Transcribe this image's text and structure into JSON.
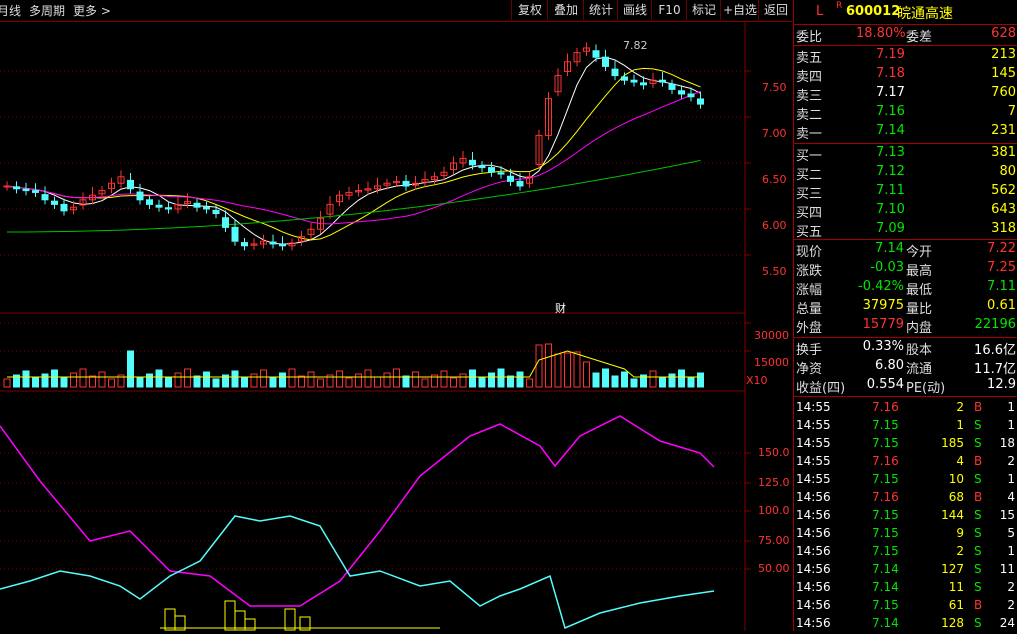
{
  "topbar": {
    "left_items": [
      "月线",
      "多周期",
      "更多 >"
    ],
    "buttons": [
      "复权",
      "叠加",
      "统计",
      "画线",
      "F10",
      "标记",
      "+自选",
      "返回"
    ]
  },
  "stock": {
    "code": "600012",
    "name": "皖通高速",
    "flag_l": "L",
    "flag_r": "R"
  },
  "colors": {
    "up": "#ff3232",
    "down": "#54fcfc",
    "flat": "#ffffff",
    "ma5": "#ffffff",
    "ma10": "#ffff00",
    "ma20": "#ff00ff",
    "ma60": "#00c000",
    "grid": "#800000"
  },
  "main_chart": {
    "peak_label": "7.82",
    "price_ticks": [
      "7.50",
      "7.00",
      "6.50",
      "6.00",
      "5.50"
    ],
    "marker": "财"
  },
  "volume_chart": {
    "ticks": [
      "30000",
      "15000"
    ],
    "unit": "X10"
  },
  "indicator_chart": {
    "ticks": [
      "150.0",
      "125.0",
      "100.0",
      "75.00",
      "50.00"
    ]
  },
  "quote": {
    "weibi": {
      "label": "委比",
      "value": "18.80%",
      "label2": "委差",
      "value2": "628"
    },
    "asks": [
      {
        "label": "卖五",
        "price": "7.19",
        "vol": "213"
      },
      {
        "label": "卖四",
        "price": "7.18",
        "vol": "145"
      },
      {
        "label": "卖三",
        "price": "7.17",
        "vol": "760"
      },
      {
        "label": "卖二",
        "price": "7.16",
        "vol": "7"
      },
      {
        "label": "卖一",
        "price": "7.14",
        "vol": "231"
      }
    ],
    "bids": [
      {
        "label": "买一",
        "price": "7.13",
        "vol": "381"
      },
      {
        "label": "买二",
        "price": "7.12",
        "vol": "80"
      },
      {
        "label": "买三",
        "price": "7.11",
        "vol": "562"
      },
      {
        "label": "买四",
        "price": "7.10",
        "vol": "643"
      },
      {
        "label": "买五",
        "price": "7.09",
        "vol": "318"
      }
    ],
    "stats": [
      {
        "l1": "现价",
        "v1": "7.14",
        "l2": "今开",
        "v2": "7.22"
      },
      {
        "l1": "涨跌",
        "v1": "-0.03",
        "l2": "最高",
        "v2": "7.25"
      },
      {
        "l1": "涨幅",
        "v1": "-0.42%",
        "l2": "最低",
        "v2": "7.11"
      },
      {
        "l1": "总量",
        "v1": "37975",
        "l2": "量比",
        "v2": "0.61"
      },
      {
        "l1": "外盘",
        "v1": "15779",
        "l2": "内盘",
        "v2": "22196"
      }
    ],
    "fund": [
      {
        "l1": "换手",
        "v1": "0.33%",
        "l2": "股本",
        "v2": "16.6亿"
      },
      {
        "l1": "净资",
        "v1": "6.80",
        "l2": "流通",
        "v2": "11.7亿"
      },
      {
        "l1": "收益(四)",
        "v1": "0.554",
        "l2": "PE(动)",
        "v2": "12.9"
      }
    ],
    "ticks": [
      {
        "time": "14:55",
        "price": "7.16",
        "vol": "2",
        "side": "B",
        "n": "1"
      },
      {
        "time": "14:55",
        "price": "7.15",
        "vol": "1",
        "side": "S",
        "n": "1"
      },
      {
        "time": "14:55",
        "price": "7.15",
        "vol": "185",
        "side": "S",
        "n": "18"
      },
      {
        "time": "14:55",
        "price": "7.16",
        "vol": "4",
        "side": "B",
        "n": "2"
      },
      {
        "time": "14:55",
        "price": "7.15",
        "vol": "10",
        "side": "S",
        "n": "1"
      },
      {
        "time": "14:56",
        "price": "7.16",
        "vol": "68",
        "side": "B",
        "n": "4"
      },
      {
        "time": "14:56",
        "price": "7.15",
        "vol": "144",
        "side": "S",
        "n": "15"
      },
      {
        "time": "14:56",
        "price": "7.15",
        "vol": "9",
        "side": "S",
        "n": "5"
      },
      {
        "time": "14:56",
        "price": "7.15",
        "vol": "2",
        "side": "S",
        "n": "1"
      },
      {
        "time": "14:56",
        "price": "7.14",
        "vol": "127",
        "side": "S",
        "n": "11"
      },
      {
        "time": "14:56",
        "price": "7.14",
        "vol": "11",
        "side": "S",
        "n": "2"
      },
      {
        "time": "14:56",
        "price": "7.15",
        "vol": "61",
        "side": "B",
        "n": "2"
      },
      {
        "time": "14:56",
        "price": "7.14",
        "vol": "128",
        "side": "S",
        "n": "24"
      }
    ]
  }
}
